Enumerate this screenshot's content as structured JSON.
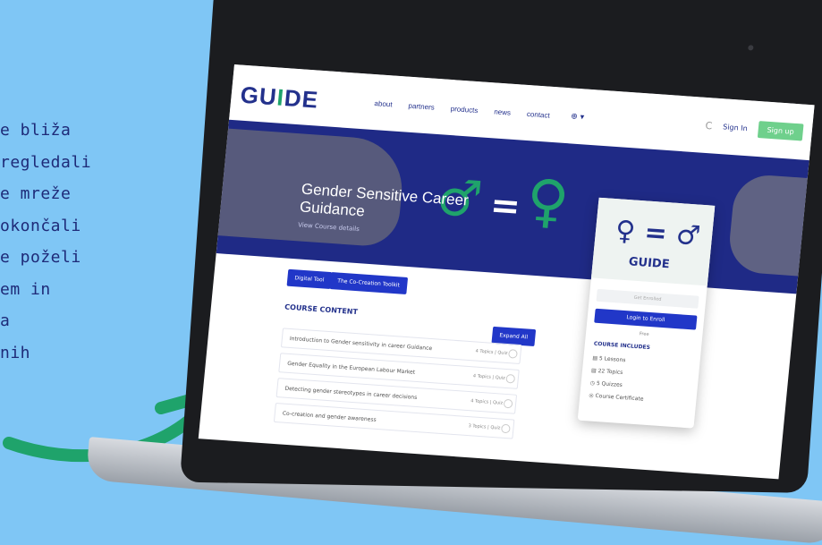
{
  "side_text": [
    "e bliža",
    "regledali",
    "e mreže",
    "okončali",
    "e poželi",
    "em in",
    "a",
    "nih"
  ],
  "site": {
    "logo_prefix": "GU",
    "logo_i": "I",
    "logo_suffix": "DE",
    "nav": [
      "about",
      "partners",
      "products",
      "news",
      "contact"
    ],
    "lang": "⊕ ▾",
    "sign_in": "Sign In",
    "sign_up": "Sign up"
  },
  "hero": {
    "title": "Gender Sensitive Career Guidance",
    "subtitle": "View Course details"
  },
  "buttons": {
    "digital_tool": "Digital Tool",
    "co_creation": "The Co-Creation Toolkit"
  },
  "course_content": {
    "title": "COURSE CONTENT",
    "expand_all": "Expand All",
    "rows": [
      {
        "label": "Introduction to Gender sensitivity in career Guidance",
        "meta": "4 Topics | Quiz"
      },
      {
        "label": "Gender Equality in the European Labour Market",
        "meta": "4 Topics | Quiz"
      },
      {
        "label": "Detecting gender stereotypes in career decisions",
        "meta": "4 Topics | Quiz"
      },
      {
        "label": "Co-creation and gender awareness",
        "meta": "3 Topics | Quiz"
      }
    ]
  },
  "sidebar_card": {
    "logo_text": "GUIDE",
    "symbol": "♀ = ♂",
    "enroll_placeholder": "Get Enrolled",
    "login_button": "Login to Enroll",
    "price": "Free",
    "includes_title": "COURSE INCLUDES",
    "includes": [
      "5 Lessons",
      "22 Topics",
      "5 Quizzes",
      "Course Certificate"
    ]
  },
  "colors": {
    "background": "#7fc6f5",
    "brand_blue": "#23318c",
    "brand_green": "#1fa36b",
    "button_blue": "#2137c8"
  }
}
